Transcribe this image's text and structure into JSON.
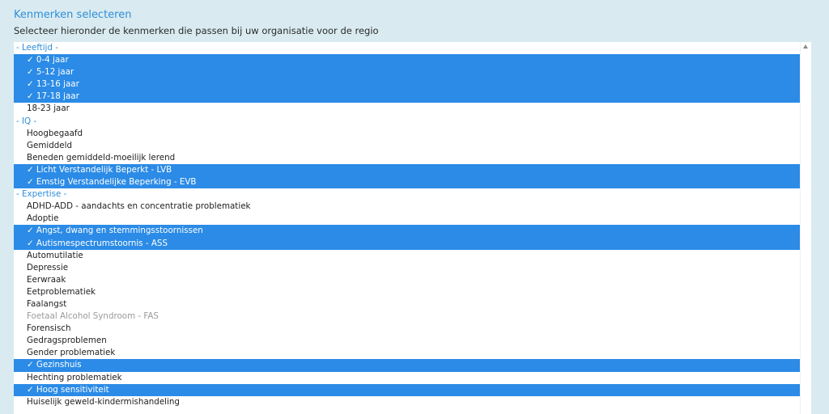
{
  "title": "Kenmerken selecteren",
  "subtitle": "Selecteer hieronder de kenmerken die passen bij uw organisatie voor de regio",
  "colors": {
    "background": "#d9ebf1",
    "accent": "#2f8ed8",
    "selected_background": "#2b8be6",
    "disabled_text": "#9a9a9a"
  },
  "listbox": {
    "items": [
      {
        "kind": "group",
        "label": "- Leeftijd -",
        "selected": false,
        "disabled": false
      },
      {
        "kind": "option",
        "label": "✓ 0-4 jaar",
        "selected": true,
        "disabled": false
      },
      {
        "kind": "option",
        "label": "✓ 5-12 jaar",
        "selected": true,
        "disabled": false
      },
      {
        "kind": "option",
        "label": "✓ 13-16 jaar",
        "selected": true,
        "disabled": false
      },
      {
        "kind": "option",
        "label": "✓ 17-18 jaar",
        "selected": true,
        "disabled": false
      },
      {
        "kind": "option",
        "label": "18-23 jaar",
        "selected": false,
        "disabled": false
      },
      {
        "kind": "group",
        "label": "- IQ -",
        "selected": false,
        "disabled": false
      },
      {
        "kind": "option",
        "label": "Hoogbegaafd",
        "selected": false,
        "disabled": false
      },
      {
        "kind": "option",
        "label": "Gemiddeld",
        "selected": false,
        "disabled": false
      },
      {
        "kind": "option",
        "label": "Beneden gemiddeld-moeilijk lerend",
        "selected": false,
        "disabled": false
      },
      {
        "kind": "option",
        "label": "✓ Licht Verstandelijk Beperkt - LVB",
        "selected": true,
        "disabled": false
      },
      {
        "kind": "option",
        "label": "✓ Emstig Verstandelijke Beperking - EVB",
        "selected": true,
        "disabled": false
      },
      {
        "kind": "group",
        "label": "- Expertise -",
        "selected": false,
        "disabled": false
      },
      {
        "kind": "option",
        "label": "ADHD-ADD - aandachts en concentratie problematiek",
        "selected": false,
        "disabled": false
      },
      {
        "kind": "option",
        "label": "Adoptie",
        "selected": false,
        "disabled": false
      },
      {
        "kind": "option",
        "label": "✓ Angst, dwang en stemmingsstoornissen",
        "selected": true,
        "disabled": false
      },
      {
        "kind": "option",
        "label": "✓ Autismespectrumstoornis - ASS",
        "selected": true,
        "disabled": false
      },
      {
        "kind": "option",
        "label": "Automutilatie",
        "selected": false,
        "disabled": false
      },
      {
        "kind": "option",
        "label": "Depressie",
        "selected": false,
        "disabled": false
      },
      {
        "kind": "option",
        "label": "Eerwraak",
        "selected": false,
        "disabled": false
      },
      {
        "kind": "option",
        "label": "Eetproblematiek",
        "selected": false,
        "disabled": false
      },
      {
        "kind": "option",
        "label": "Faalangst",
        "selected": false,
        "disabled": false
      },
      {
        "kind": "option",
        "label": "Foetaal Alcohol Syndroom - FAS",
        "selected": false,
        "disabled": true
      },
      {
        "kind": "option",
        "label": "Forensisch",
        "selected": false,
        "disabled": false
      },
      {
        "kind": "option",
        "label": "Gedragsproblemen",
        "selected": false,
        "disabled": false
      },
      {
        "kind": "option",
        "label": "Gender problematiek",
        "selected": false,
        "disabled": false
      },
      {
        "kind": "option",
        "label": "✓ Gezinshuis",
        "selected": true,
        "disabled": false
      },
      {
        "kind": "option",
        "label": "Hechting problematiek",
        "selected": false,
        "disabled": false
      },
      {
        "kind": "option",
        "label": "✓ Hoog sensitiviteit",
        "selected": true,
        "disabled": false
      },
      {
        "kind": "option",
        "label": "Huiselijk geweld-kindermishandeling",
        "selected": false,
        "disabled": false
      }
    ]
  }
}
